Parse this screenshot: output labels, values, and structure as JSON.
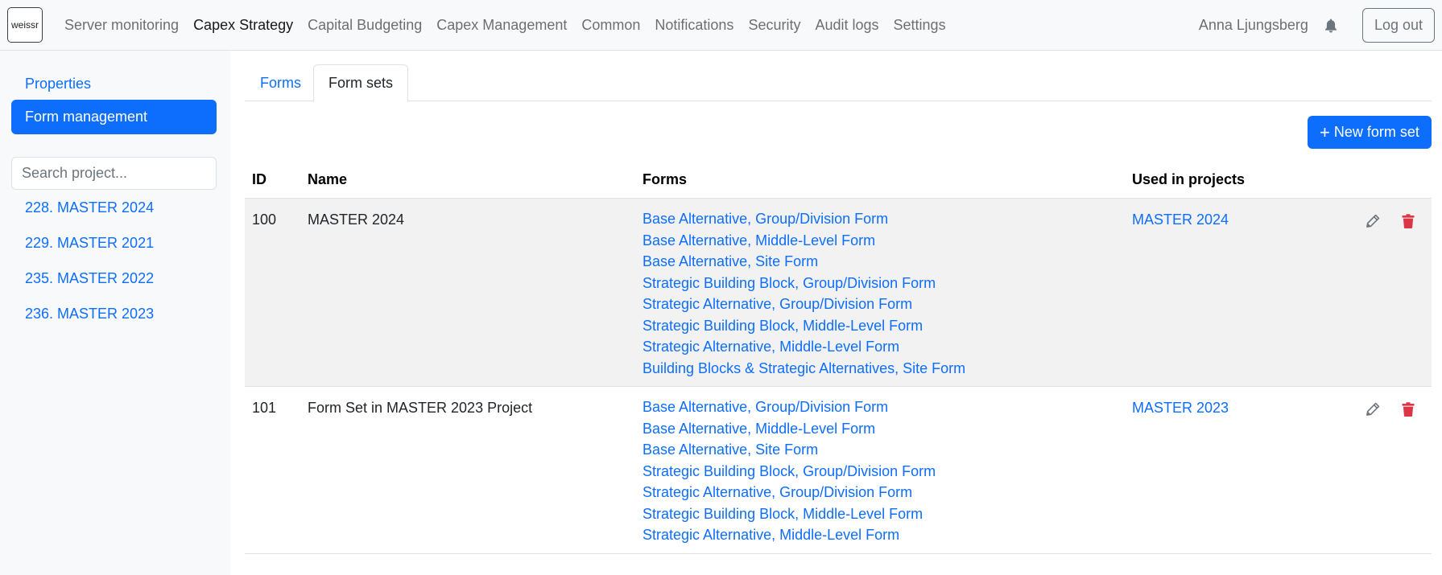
{
  "app": {
    "logo_text": "weissr"
  },
  "nav": {
    "items": [
      {
        "label": "Server monitoring"
      },
      {
        "label": "Capex Strategy"
      },
      {
        "label": "Capital Budgeting"
      },
      {
        "label": "Capex Management"
      },
      {
        "label": "Common"
      },
      {
        "label": "Notifications"
      },
      {
        "label": "Security"
      },
      {
        "label": "Audit logs"
      },
      {
        "label": "Settings"
      }
    ],
    "active_index": 1,
    "user_name": "Anna Ljungsberg",
    "logout_label": "Log out",
    "bell_icon": "bell-icon"
  },
  "sidebar": {
    "links": [
      {
        "label": "Properties"
      },
      {
        "label": "Form management"
      }
    ],
    "active_index": 1,
    "search": {
      "placeholder": "Search project...",
      "value": ""
    },
    "projects": [
      {
        "label": "228. MASTER 2024"
      },
      {
        "label": "229. MASTER 2021"
      },
      {
        "label": "235. MASTER 2022"
      },
      {
        "label": "236. MASTER 2023"
      }
    ]
  },
  "main": {
    "tabs": [
      {
        "label": "Forms"
      },
      {
        "label": "Form sets"
      }
    ],
    "active_tab": 1,
    "new_button_label": "New form set",
    "table": {
      "headers": {
        "id": "ID",
        "name": "Name",
        "forms": "Forms",
        "used": "Used in projects"
      },
      "rows": [
        {
          "id": "100",
          "name": "MASTER 2024",
          "forms": [
            "Base Alternative, Group/Division Form",
            "Base Alternative, Middle-Level Form",
            "Base Alternative, Site Form",
            "Strategic Building Block, Group/Division Form",
            "Strategic Alternative, Group/Division Form",
            "Strategic Building Block, Middle-Level Form",
            "Strategic Alternative, Middle-Level Form",
            "Building Blocks & Strategic Alternatives, Site Form"
          ],
          "used_in": "MASTER 2024"
        },
        {
          "id": "101",
          "name": "Form Set in MASTER 2023 Project",
          "forms": [
            "Base Alternative, Group/Division Form",
            "Base Alternative, Middle-Level Form",
            "Base Alternative, Site Form",
            "Strategic Building Block, Group/Division Form",
            "Strategic Alternative, Group/Division Form",
            "Strategic Building Block, Middle-Level Form",
            "Strategic Alternative, Middle-Level Form"
          ],
          "used_in": "MASTER 2023"
        }
      ]
    }
  },
  "colors": {
    "primary": "#0d6efd",
    "danger": "#dc3545",
    "edit_icon": "#6c757d",
    "navbar_bg": "#f8f9fa",
    "row_stripe": "#f2f2f2"
  }
}
